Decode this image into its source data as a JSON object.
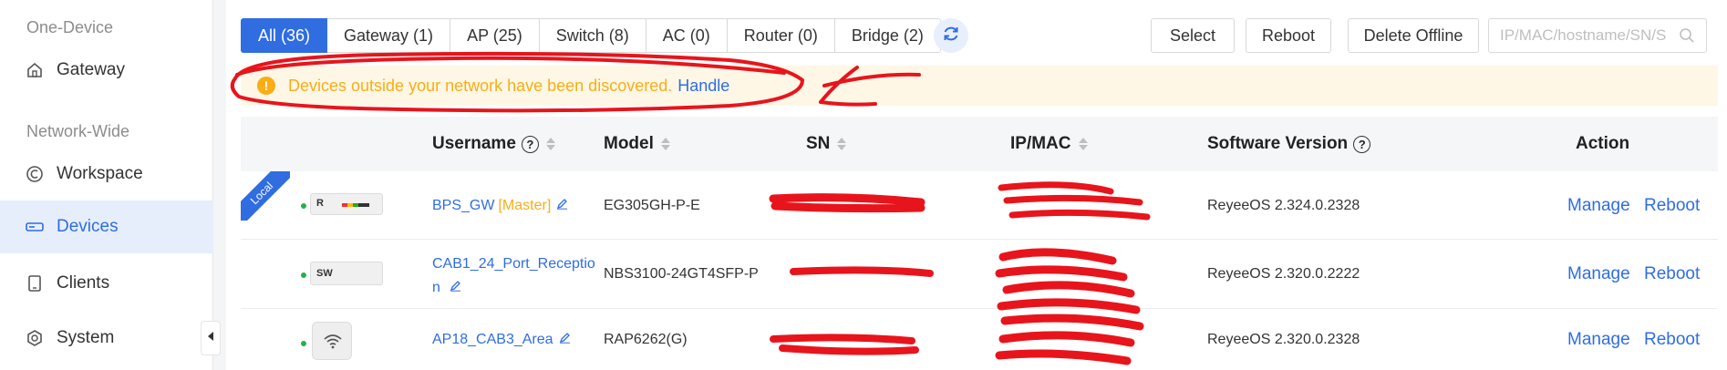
{
  "sidebar": {
    "group1": "One-Device",
    "group2": "Network-Wide",
    "items": [
      {
        "label": "Gateway",
        "icon": "home-icon"
      },
      {
        "label": "Workspace",
        "icon": "workspace-icon"
      },
      {
        "label": "Devices",
        "icon": "devices-icon",
        "active": true
      },
      {
        "label": "Clients",
        "icon": "clients-icon"
      },
      {
        "label": "System",
        "icon": "system-icon"
      }
    ]
  },
  "tabs": [
    {
      "label": "All (36)",
      "active": true
    },
    {
      "label": "Gateway (1)"
    },
    {
      "label": "AP (25)"
    },
    {
      "label": "Switch (8)"
    },
    {
      "label": "AC (0)"
    },
    {
      "label": "Router (0)"
    },
    {
      "label": "Bridge (2)"
    }
  ],
  "toolbar": {
    "select_label": "Select",
    "reboot_label": "Reboot",
    "delete_offline_label": "Delete Offline",
    "search_placeholder": "IP/MAC/hostname/SN/S"
  },
  "alert": {
    "message": "Devices outside your network have been discovered.",
    "action": "Handle"
  },
  "table": {
    "headers": {
      "username": "Username",
      "model": "Model",
      "sn": "SN",
      "ipmac": "IP/MAC",
      "software": "Software Version",
      "action": "Action"
    },
    "rows": [
      {
        "username": "BPS_GW",
        "tag": "[Master]",
        "model": "EG305GH-P-E",
        "software": "ReyeeOS 2.324.0.2328",
        "manage": "Manage",
        "reboot": "Reboot",
        "badge": "Local",
        "device_letter": "R"
      },
      {
        "username_line1": "CAB1_24_Port_Receptio",
        "username_line2": "n",
        "model": "NBS3100-24GT4SFP-P",
        "software": "ReyeeOS 2.320.0.2222",
        "manage": "Manage",
        "reboot": "Reboot",
        "device_letter": "SW"
      },
      {
        "username": "AP18_CAB3_Area",
        "model": "RAP6262(G)",
        "software": "ReyeeOS 2.320.0.2328",
        "manage": "Manage",
        "reboot": "Reboot"
      }
    ]
  },
  "colors": {
    "accent": "#2f6de1",
    "warning": "#faad14",
    "online": "#23b24b",
    "annotation": "#e8141c"
  }
}
